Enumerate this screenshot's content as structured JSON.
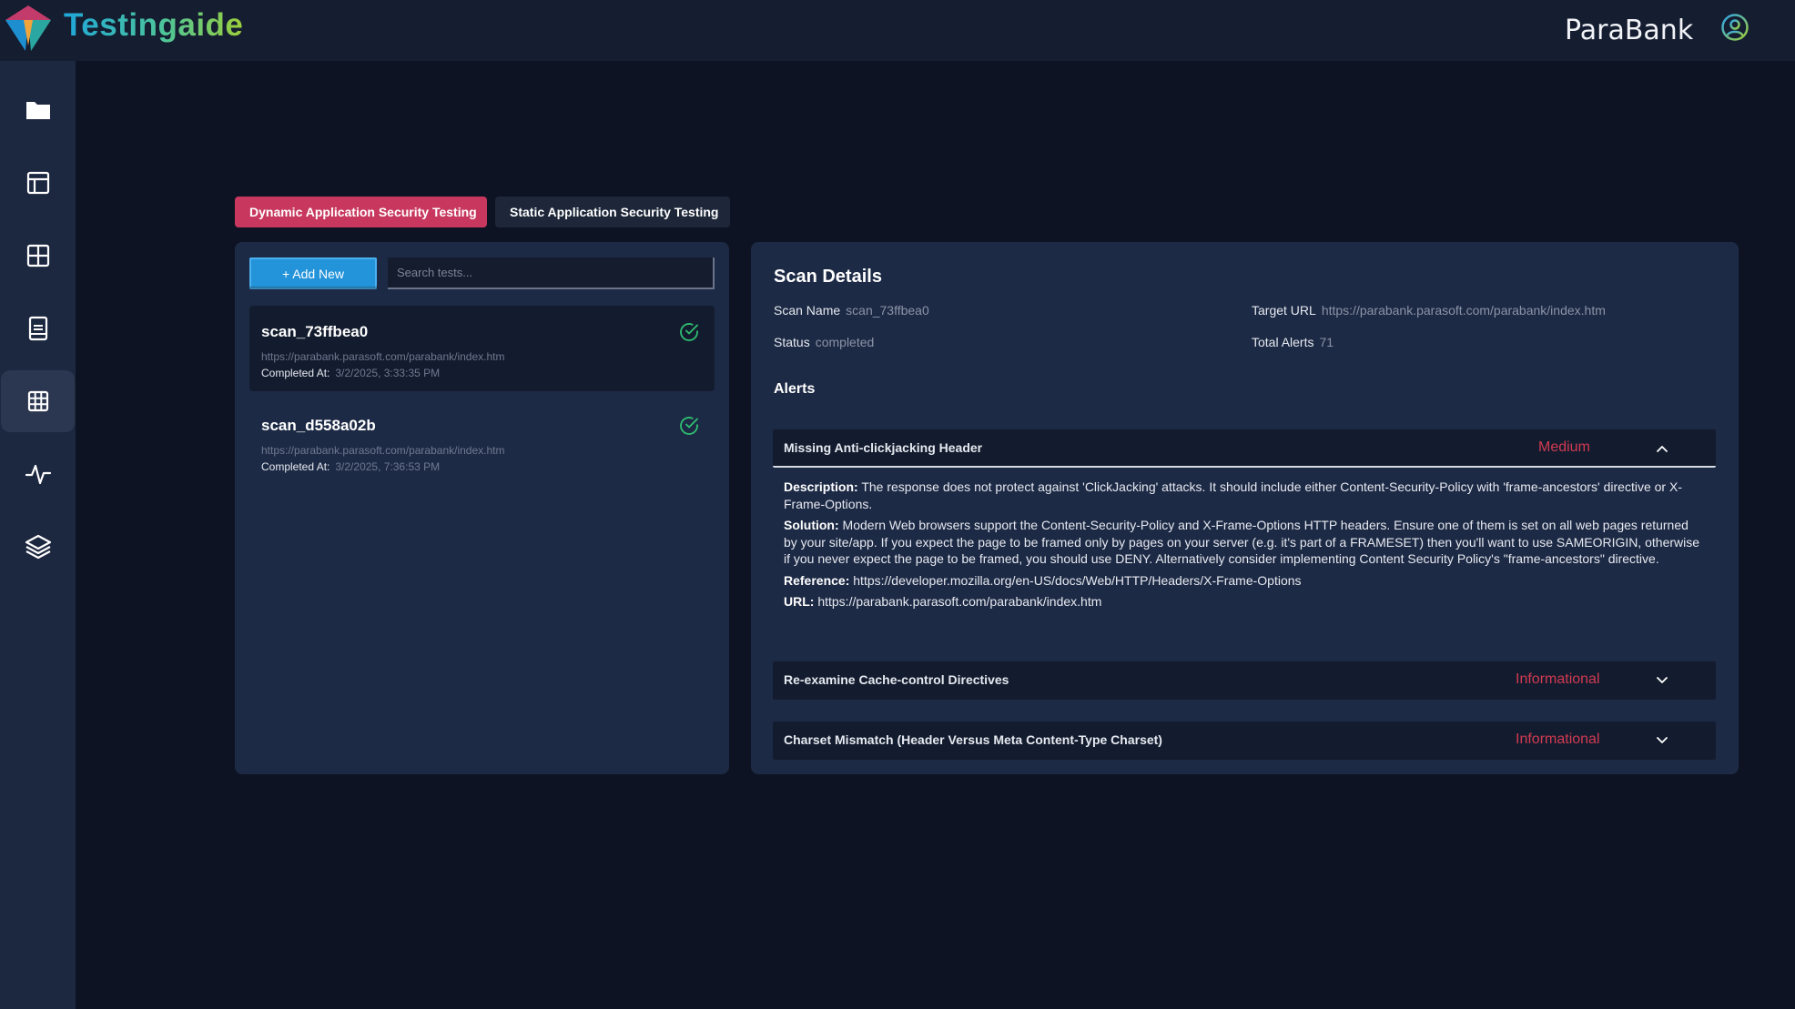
{
  "app": {
    "brand": "Testingaide",
    "project": "ParaBank"
  },
  "tabs": [
    {
      "label": "Dynamic Application Security Testing",
      "active": true
    },
    {
      "label": "Static Application Security Testing",
      "active": false
    }
  ],
  "left": {
    "add_label": "+ Add New",
    "search_placeholder": "Search tests...",
    "scans": [
      {
        "name": "scan_73ffbea0",
        "url": "https://parabank.parasoft.com/parabank/index.htm",
        "completed_label": "Completed At:",
        "completed_at": "3/2/2025, 3:33:35 PM"
      },
      {
        "name": "scan_d558a02b",
        "url": "https://parabank.parasoft.com/parabank/index.htm",
        "completed_label": "Completed At:",
        "completed_at": "3/2/2025, 7:36:53 PM"
      }
    ]
  },
  "details": {
    "title": "Scan Details",
    "scan_name_label": "Scan Name",
    "scan_name": "scan_73ffbea0",
    "target_url_label": "Target URL",
    "target_url": "https://parabank.parasoft.com/parabank/index.htm",
    "status_label": "Status",
    "status": "completed",
    "total_alerts_label": "Total Alerts",
    "total_alerts": "71",
    "alerts_title": "Alerts",
    "alerts": [
      {
        "title": "Missing Anti-clickjacking Header",
        "severity": "Medium",
        "expanded": true,
        "description_label": "Description:",
        "description": "The response does not protect against 'ClickJacking' attacks. It should include either Content-Security-Policy with 'frame-ancestors' directive or X-Frame-Options.",
        "solution_label": "Solution:",
        "solution": "Modern Web browsers support the Content-Security-Policy and X-Frame-Options HTTP headers. Ensure one of them is set on all web pages returned by your site/app. If you expect the page to be framed only by pages on your server (e.g. it's part of a FRAMESET) then you'll want to use SAMEORIGIN, otherwise if you never expect the page to be framed, you should use DENY. Alternatively consider implementing Content Security Policy's \"frame-ancestors\" directive.",
        "reference_label": "Reference:",
        "reference": "https://developer.mozilla.org/en-US/docs/Web/HTTP/Headers/X-Frame-Options",
        "url_label": "URL:",
        "url": "https://parabank.parasoft.com/parabank/index.htm"
      },
      {
        "title": "Re-examine Cache-control Directives",
        "severity": "Informational",
        "expanded": false
      },
      {
        "title": "Charset Mismatch (Header Versus Meta Content-Type Charset)",
        "severity": "Informational",
        "expanded": false
      }
    ]
  },
  "colors": {
    "accent_tab": "#c8385e",
    "add_button": "#2393da",
    "severity": "#d23a52",
    "success": "#2fbf71"
  },
  "icons": {
    "sidebar": [
      "folder-icon",
      "layout-icon",
      "plus-square-icon",
      "document-icon",
      "grid-icon",
      "activity-icon",
      "layers-icon"
    ],
    "user": "user-circle-icon",
    "status": "check-circle-icon"
  }
}
